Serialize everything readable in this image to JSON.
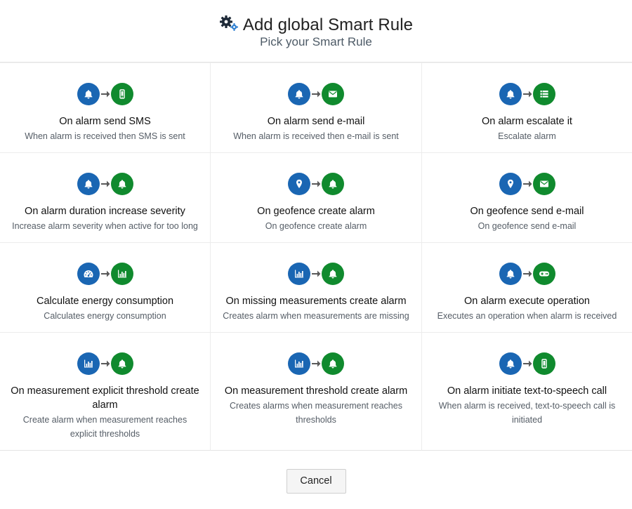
{
  "header": {
    "title": "Add global Smart Rule",
    "subtitle": "Pick your Smart Rule",
    "icon": "gears-icon"
  },
  "colors": {
    "trigger": "#1a66b3",
    "action": "#108a2e",
    "arrow": "#5a5a5a"
  },
  "rules": [
    {
      "name": "On alarm send SMS",
      "description": "When alarm is received then SMS is sent",
      "from_icon": "bell-icon",
      "to_icon": "mobile-icon"
    },
    {
      "name": "On alarm send e-mail",
      "description": "When alarm is received then e-mail is sent",
      "from_icon": "bell-icon",
      "to_icon": "envelope-icon"
    },
    {
      "name": "On alarm escalate it",
      "description": "Escalate alarm",
      "from_icon": "bell-icon",
      "to_icon": "list-icon"
    },
    {
      "name": "On alarm duration increase severity",
      "description": "Increase alarm severity when active for too long",
      "from_icon": "bell-icon",
      "to_icon": "bell-icon"
    },
    {
      "name": "On geofence create alarm",
      "description": "On geofence create alarm",
      "from_icon": "map-marker-icon",
      "to_icon": "bell-icon"
    },
    {
      "name": "On geofence send e-mail",
      "description": "On geofence send e-mail",
      "from_icon": "map-marker-icon",
      "to_icon": "envelope-icon"
    },
    {
      "name": "Calculate energy consumption",
      "description": "Calculates energy consumption",
      "from_icon": "dashboard-icon",
      "to_icon": "bar-chart-icon"
    },
    {
      "name": "On missing measurements create alarm",
      "description": "Creates alarm when measurements are missing",
      "from_icon": "bar-chart-icon",
      "to_icon": "bell-icon"
    },
    {
      "name": "On alarm execute operation",
      "description": "Executes an operation when alarm is received",
      "from_icon": "bell-icon",
      "to_icon": "gamepad-icon"
    },
    {
      "name": "On measurement explicit threshold create alarm",
      "description": "Create alarm when measurement reaches explicit thresholds",
      "from_icon": "bar-chart-icon",
      "to_icon": "bell-icon"
    },
    {
      "name": "On measurement threshold create alarm",
      "description": "Creates alarms when measurement reaches thresholds",
      "from_icon": "bar-chart-icon",
      "to_icon": "bell-icon"
    },
    {
      "name": "On alarm initiate text-to-speech call",
      "description": "When alarm is received, text-to-speech call is initiated",
      "from_icon": "bell-icon",
      "to_icon": "mobile-icon"
    }
  ],
  "footer": {
    "cancel_label": "Cancel"
  }
}
